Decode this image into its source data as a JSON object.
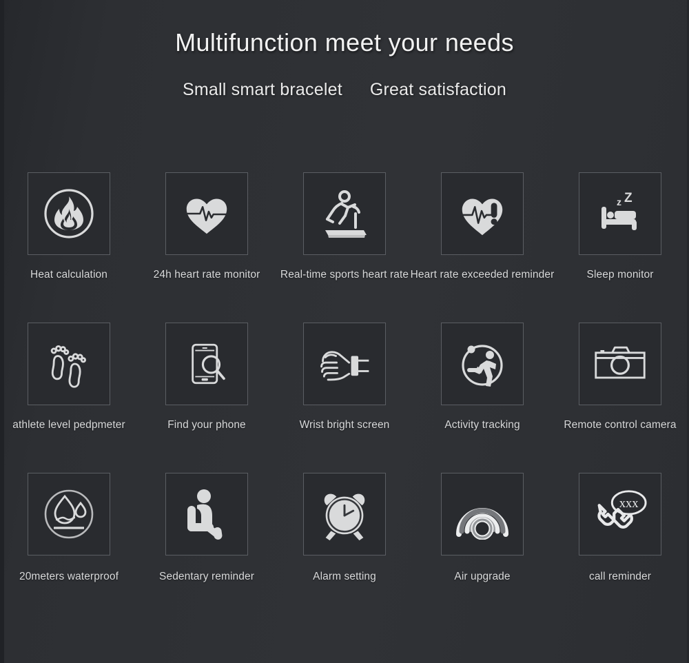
{
  "header": {
    "title": "Multifunction meet your needs",
    "subtitle_left": "Small smart bracelet",
    "subtitle_right": "Great satisfaction"
  },
  "colors": {
    "background": "#2d2f33",
    "panel": "#292b2f",
    "box_border": "#5b5e63",
    "title_text": "#f2f2f2",
    "caption_text": "#d8d9da",
    "icon_fill": "#d9dadb"
  },
  "features": [
    {
      "icon": "flame-circle-icon",
      "label": "Heat calculation"
    },
    {
      "icon": "heart-pulse-icon",
      "label": "24h heart rate monitor"
    },
    {
      "icon": "treadmill-runner-icon",
      "label": "Real-time sports heart rate"
    },
    {
      "icon": "heart-alert-icon",
      "label": "Heart rate exceeded reminder"
    },
    {
      "icon": "bed-sleep-icon",
      "label": "Sleep monitor"
    },
    {
      "icon": "footprints-icon",
      "label": "athlete level pedpmeter"
    },
    {
      "icon": "phone-search-icon",
      "label": "Find your phone"
    },
    {
      "icon": "wrist-band-icon",
      "label": "Wrist bright screen"
    },
    {
      "icon": "runner-circle-icon",
      "label": "Activity tracking"
    },
    {
      "icon": "camera-icon",
      "label": "Remote control camera"
    },
    {
      "icon": "waterdrop-circle-icon",
      "label": "20meters waterproof"
    },
    {
      "icon": "sitting-person-icon",
      "label": "Sedentary reminder"
    },
    {
      "icon": "alarm-clock-icon",
      "label": "Alarm setting"
    },
    {
      "icon": "broadcast-waves-icon",
      "label": "Air upgrade"
    },
    {
      "icon": "phone-call-xxx-icon",
      "label": "call reminder"
    }
  ]
}
